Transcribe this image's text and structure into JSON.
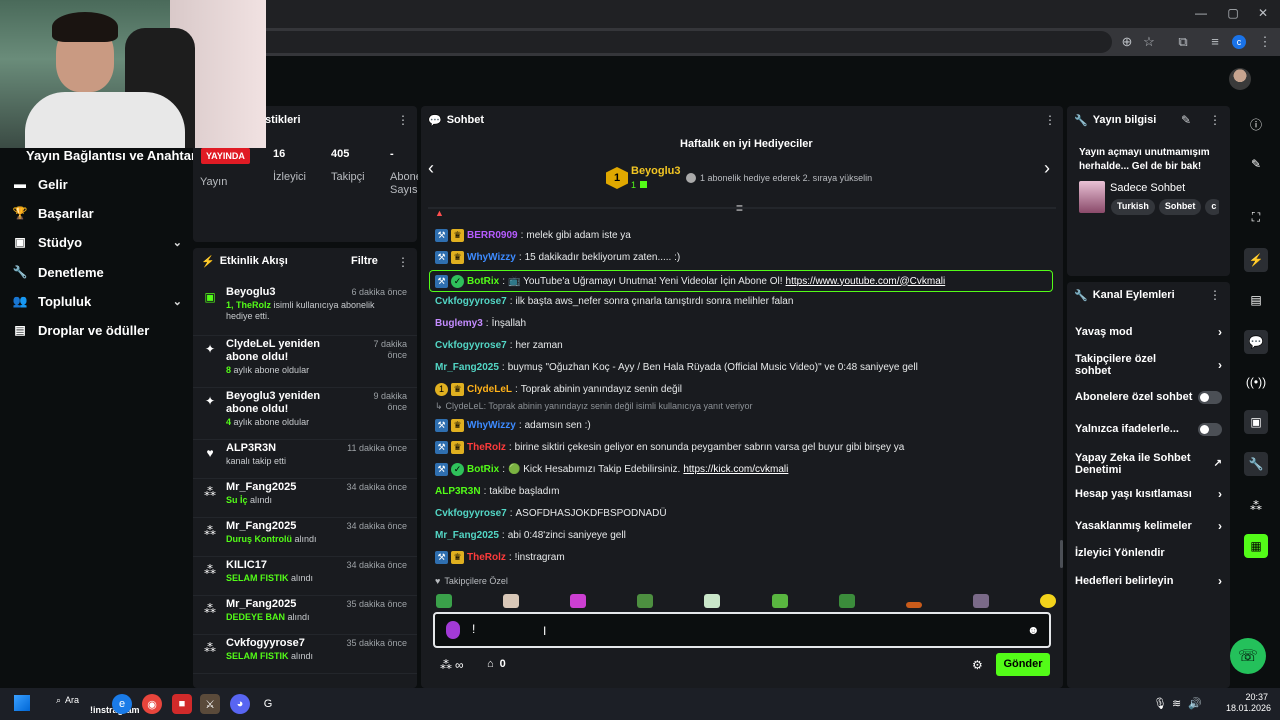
{
  "browser": {
    "window_controls": [
      "—",
      "▢",
      "✕"
    ]
  },
  "sidebar": {
    "title": "Yayın Bağlantısı ve Anahtarı",
    "items": [
      {
        "label": "Gelir",
        "icon": "money-icon"
      },
      {
        "label": "Başarılar",
        "icon": "trophy-icon"
      },
      {
        "label": "Stüdyo",
        "icon": "studio-icon",
        "expandable": true
      },
      {
        "label": "Denetleme",
        "icon": "wrench-icon"
      },
      {
        "label": "Topluluk",
        "icon": "community-icon",
        "expandable": true
      },
      {
        "label": "Droplar ve ödüller",
        "icon": "drops-icon"
      }
    ]
  },
  "stats": {
    "title_partial": "istikleri",
    "live_badge": "YAYINDA",
    "live_label": "Yayın",
    "viewers": {
      "value": "16",
      "label": "İzleyici"
    },
    "followers": {
      "value": "405",
      "label": "Takipçi"
    },
    "subs": {
      "value": "-",
      "label": "Abone Sayısı"
    }
  },
  "activity": {
    "title": "Etkinlik Akışı",
    "filter": "Filtre",
    "items": [
      {
        "name": "Beyoglu3",
        "time": "6 dakika önce",
        "desc_bold": "1, TheRolz",
        "desc": " isimli kullanıcıya abonelik hediye etti.",
        "icon": "gift-icon"
      },
      {
        "name": "ClydeLeL yeniden abone oldu!",
        "time": "7 dakika önce",
        "desc_bold": "8",
        "desc": " aylık abone oldular",
        "icon": "sparkle-icon"
      },
      {
        "name": "Beyoglu3 yeniden abone oldu!",
        "time": "9 dakika önce",
        "desc_bold": "4",
        "desc": " aylık abone oldular",
        "icon": "sparkle-icon"
      },
      {
        "name": "ALP3R3N",
        "time": "11 dakika önce",
        "desc_bold": "",
        "desc": "kanalı takip etti",
        "icon": "heart-icon"
      },
      {
        "name": "Mr_Fang2025",
        "time": "34 dakika önce",
        "desc_bold": "Su İç",
        "desc": " alındı",
        "icon": "points-icon"
      },
      {
        "name": "Mr_Fang2025",
        "time": "34 dakika önce",
        "desc_bold": "Duruş Kontrolü",
        "desc": " alındı",
        "icon": "points-icon"
      },
      {
        "name": "KILIC17",
        "time": "34 dakika önce",
        "desc_bold": "SELAM FISTIK",
        "desc": " alındı",
        "icon": "points-icon"
      },
      {
        "name": "Mr_Fang2025",
        "time": "35 dakika önce",
        "desc_bold": "DEDEYE BAN",
        "desc": " alındı",
        "icon": "points-icon"
      },
      {
        "name": "Cvkfogyyrose7",
        "time": "35 dakika önce",
        "desc_bold": "SELAM FISTIK",
        "desc": " alındı",
        "icon": "points-icon"
      }
    ]
  },
  "chat": {
    "title": "Sohbet",
    "gifters_title": "Haftalık en iyi Hediyeciler",
    "top_gifter": {
      "rank": "1",
      "name": "Beyoglu3",
      "count": "1"
    },
    "gifter_hint": "1 abonelik hediye ederek 2. sıraya yükselin",
    "messages": [
      {
        "user": "BERR0909",
        "color": "#b65cff",
        "text": "melek gibi adam iste ya",
        "badges": "kc"
      },
      {
        "user": "WhyWizzy",
        "color": "#3d8bff",
        "text": "15 dakikadır bekliyorum zaten..... :)",
        "badges": "kc"
      },
      {
        "user": "BotRix",
        "color": "#53fc18",
        "text": "📺 YouTube'a Uğramayı Unutma! Yeni Videolar İçin Abone Ol! ",
        "link": "https://www.youtube.com/@Cvkmali",
        "badges": "kg",
        "highlight": true
      },
      {
        "user": "Cvkfogyyrose7",
        "color": "#53d6c5",
        "text": "ilk başta aws_nefer sonra çınarla tanıştırdı sonra melihler falan",
        "badges": ""
      },
      {
        "user": "Buglemy3",
        "color": "#c48cff",
        "text": "İnşallah",
        "badges": ""
      },
      {
        "user": "Cvkfogyyrose7",
        "color": "#53d6c5",
        "text": "her zaman",
        "badges": ""
      },
      {
        "user": "Mr_Fang2025",
        "color": "#53d6c5",
        "text": "buymuş \"Oğuzhan Koç - Ayy / Ben Hala Rüyada (Official Music Video)\" ve 0:48 saniyeye gell",
        "badges": ""
      },
      {
        "user": "ClydeLeL",
        "color": "#ffb21a",
        "text": "Toprak abinin yanındayız senin değil",
        "badges": "nc"
      },
      {
        "reply": "ClydeLeL: Toprak abinin yanındayız senin değil isimli kullanıcıya yanıt veriyor"
      },
      {
        "user": "WhyWizzy",
        "color": "#3d8bff",
        "text": "adamsın sen :)",
        "badges": "kc"
      },
      {
        "user": "TheRolz",
        "color": "#ff3b3b",
        "text": "birine siktiri çekesin geliyor en sonunda peygamber sabrın varsa gel buyur gibi birşey ya",
        "badges": "kc"
      },
      {
        "user": "BotRix",
        "color": "#53fc18",
        "text": "🟢 Kick Hesabımızı Takip Edebilirsiniz. ",
        "link": "https://kick.com/cvkmali",
        "badges": "kg"
      },
      {
        "user": "ALP3R3N",
        "color": "#53fc18",
        "text": "takibe başladım",
        "badges": ""
      },
      {
        "user": "Cvkfogyyrose7",
        "color": "#53d6c5",
        "text": "ASOFDHASJOKDFBSPODNADÜ",
        "badges": ""
      },
      {
        "user": "Mr_Fang2025",
        "color": "#53d6c5",
        "text": "abi 0:48'zinci saniyeye gell",
        "badges": ""
      },
      {
        "user": "TheRolz",
        "color": "#ff3b3b",
        "text": "!instragram",
        "badges": "kc"
      }
    ],
    "followers_only": "Takipçilere Özel",
    "input_value": "!",
    "points": "∞",
    "store_count": "0",
    "send": "Gönder"
  },
  "stream_info": {
    "title": "Yayın bilgisi",
    "desc": "Yayın açmayı unutmamışım herhalde... Gel de bir bak!",
    "category": "Sadece Sohbet",
    "tags": [
      "Turkish",
      "Sohbet",
      "c"
    ]
  },
  "channel_actions": {
    "title": "Kanal Eylemleri",
    "items": [
      {
        "label": "Yavaş mod",
        "type": "chevron"
      },
      {
        "label": "Takipçilere özel sohbet",
        "type": "chevron"
      },
      {
        "label": "Abonelere özel sohbet",
        "type": "toggle"
      },
      {
        "label": "Yalnızca ifadelerle...",
        "type": "toggle"
      },
      {
        "label": "Yapay Zeka ile Sohbet Denetimi",
        "type": "external"
      },
      {
        "label": "Hesap yaşı kısıtlaması",
        "type": "chevron"
      },
      {
        "label": "Yasaklanmış kelimeler",
        "type": "chevron"
      },
      {
        "label": "İzleyici Yönlendir",
        "type": "none"
      },
      {
        "label": "Hedefleri belirleyin",
        "type": "chevron"
      }
    ]
  },
  "taskbar": {
    "search": "Ara",
    "search_sub": "!instragram",
    "time": "20:37",
    "date": "18.01.2026"
  }
}
